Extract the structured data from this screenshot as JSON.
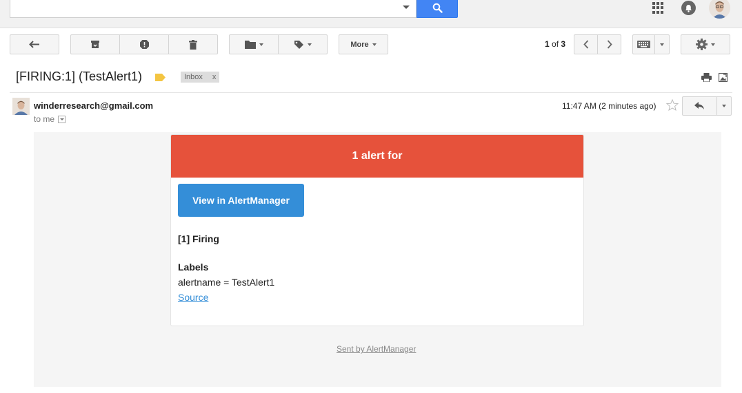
{
  "search": {
    "value": "",
    "placeholder": ""
  },
  "toolbar": {
    "more_label": "More",
    "pager": {
      "current": "1",
      "of_text": "of",
      "total": "3"
    }
  },
  "email": {
    "subject": "[FIRING:1] (TestAlert1)",
    "inbox_chip": "Inbox",
    "inbox_chip_close": "x",
    "sender": "winderresearch@gmail.com",
    "to_me": "to me",
    "timestamp": "11:47 AM (2 minutes ago)"
  },
  "alert": {
    "header": "1 alert for",
    "view_button": "View in AlertManager",
    "firing": "[1] Firing",
    "labels_heading": "Labels",
    "label_line": "alertname = TestAlert1",
    "source_link": "Source",
    "footer": "Sent by AlertManager"
  },
  "colors": {
    "alert_header": "#e6523b",
    "view_button": "#348ed8",
    "search_button": "#4285f4",
    "label_tag": "#f4c542"
  },
  "icons": {
    "back": "arrow-back-icon",
    "archive": "archive-icon",
    "spam": "report-spam-icon",
    "delete": "trash-icon",
    "move": "folder-icon",
    "labels": "label-tag-icon",
    "prev": "chevron-left-icon",
    "next": "chevron-right-icon",
    "keyboard": "keyboard-icon",
    "settings": "gear-icon",
    "print": "print-icon",
    "new_window": "new-window-icon",
    "star": "star-icon",
    "reply": "reply-icon"
  }
}
